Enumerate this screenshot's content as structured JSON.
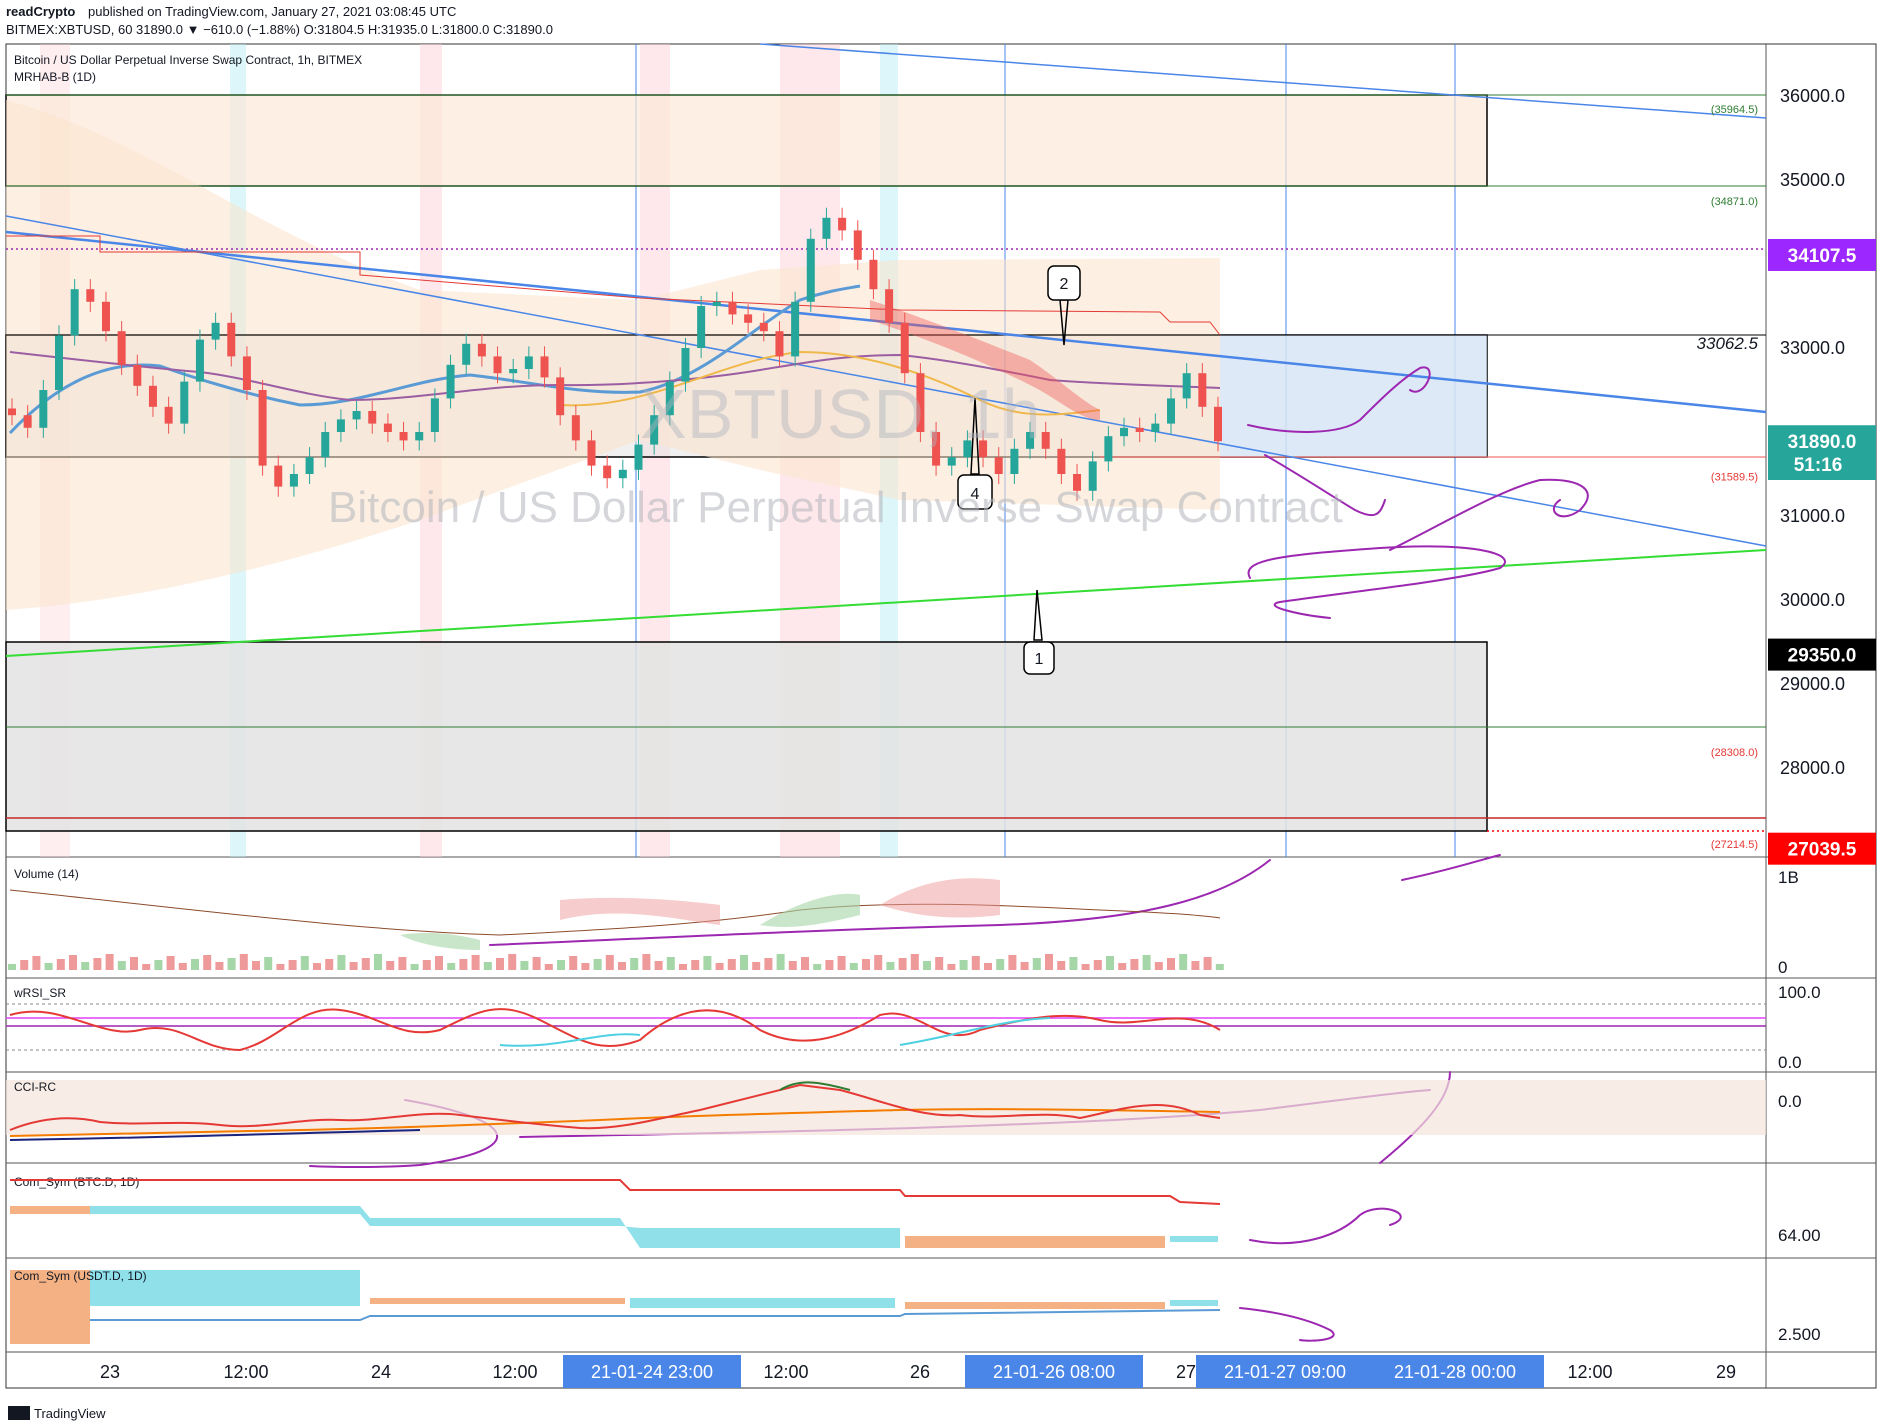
{
  "header": {
    "publisher": "readCrypto",
    "published_text": "published on TradingView.com, January 27, 2021 03:08:45 UTC",
    "ohlc_text": "BITMEX:XBTUSD, 60  31890.0 ▼ −610.0 (−1.88%) O:31804.5 H:31935.0 L:31800.0 C:31890.0"
  },
  "chart_title": "Bitcoin / US Dollar Perpetual Inverse Swap Contract, 1h, BITMEX",
  "indicator_label": "MRHAB-B (1D)",
  "watermark": {
    "ticker": "XBTUSD, 1h",
    "name": "Bitcoin / US Dollar Perpetual Inverse Swap Contract"
  },
  "footer": {
    "brand": "TradingView"
  },
  "colors": {
    "up": "#26a69a",
    "down": "#ef5350",
    "purple": "#9c27b0",
    "axis_badge": "#4a86e8"
  },
  "chart_data": [
    {
      "type": "line",
      "panel": "price",
      "ylim": [
        26500,
        36600
      ],
      "y_ticks": [
        36000,
        35000,
        33000,
        31000,
        30000,
        29000,
        28000
      ],
      "y_tick_labels": [
        "36000.0",
        "35000.0",
        "33000.0",
        "31000.0",
        "30000.0",
        "29000.0",
        "28000.0"
      ],
      "price_badges": [
        {
          "value": 34107.5,
          "label": "34107.5",
          "color": "#9c27ff"
        },
        {
          "value": 31890.0,
          "label": "31890.0",
          "color": "#26a69a"
        },
        {
          "value": 29350.0,
          "label": "29350.0",
          "color": "#000000"
        },
        {
          "value": 27039.5,
          "label": "27039.5",
          "color": "#ff0000"
        }
      ],
      "countdown": "51:16",
      "level_labels": [
        {
          "value": 35964.5,
          "label": "(35964.5)"
        },
        {
          "value": 34871.0,
          "label": "(34871.0)"
        },
        {
          "value": 33062.5,
          "label": "33062.5"
        },
        {
          "value": 31589.5,
          "label": "(31589.5)"
        },
        {
          "value": 28308.0,
          "label": "(28308.0)"
        },
        {
          "value": 27214.5,
          "label": "(27214.5)"
        }
      ],
      "callouts": [
        "1",
        "2",
        "4"
      ],
      "series": [
        {
          "values": [
            32200,
            32050,
            32500,
            33150,
            33700,
            33550,
            33200,
            32800,
            32550,
            32300,
            32100,
            32600,
            33100,
            33300,
            32900,
            32500,
            31600,
            31350,
            31500,
            31700,
            32000,
            32150,
            32250,
            32100,
            32000,
            31900,
            32000,
            32400,
            32800,
            33050,
            32900,
            32700,
            32750,
            32900,
            32650,
            32200,
            31900,
            31600,
            31450,
            31550,
            31850,
            32200,
            32600,
            33000,
            33500,
            33550,
            33400,
            33300,
            33200,
            32900,
            33550,
            34300,
            34550,
            34400,
            34050,
            33700,
            33300,
            32700,
            32000,
            31600,
            31700,
            31900,
            31700,
            31500,
            31800,
            32000,
            31800,
            31500,
            31300,
            31650,
            31950,
            32050,
            32000,
            32100,
            32400,
            32700,
            32300,
            31890
          ]
        }
      ]
    },
    {
      "type": "bar",
      "panel": "volume",
      "title": "Volume (14)",
      "y_tick_labels": [
        "1B",
        "0"
      ]
    },
    {
      "type": "line",
      "panel": "wrsi",
      "title": "wRSI_SR",
      "ylim": [
        0,
        100
      ],
      "y_tick_labels": [
        "100.0",
        "0.0"
      ]
    },
    {
      "type": "line",
      "panel": "cci",
      "title": "CCI-RC",
      "y_tick_labels": [
        "0.0"
      ]
    },
    {
      "type": "area",
      "panel": "com_btc",
      "title": "Com_Sym (BTC.D, 1D)",
      "y_tick_labels": [
        "64.00"
      ]
    },
    {
      "type": "area",
      "panel": "com_usdt",
      "title": "Com_Sym (USDT.D, 1D)",
      "y_tick_labels": [
        "2.500"
      ]
    }
  ],
  "x_axis": {
    "ticks": [
      {
        "label": "23",
        "highlight": false
      },
      {
        "label": "12:00",
        "highlight": false
      },
      {
        "label": "24",
        "highlight": false
      },
      {
        "label": "12:00",
        "highlight": false
      },
      {
        "label": "21-01-24   23:00",
        "highlight": true
      },
      {
        "label": "12:00",
        "highlight": false
      },
      {
        "label": "26",
        "highlight": false
      },
      {
        "label": "21-01-26   08:00",
        "highlight": true
      },
      {
        "label": "27",
        "highlight": false
      },
      {
        "label": "21-01-27   09:00",
        "highlight": true
      },
      {
        "label": "21-01-28   00:00",
        "highlight": true
      },
      {
        "label": "12:00",
        "highlight": false
      },
      {
        "label": "29",
        "highlight": false
      }
    ]
  }
}
